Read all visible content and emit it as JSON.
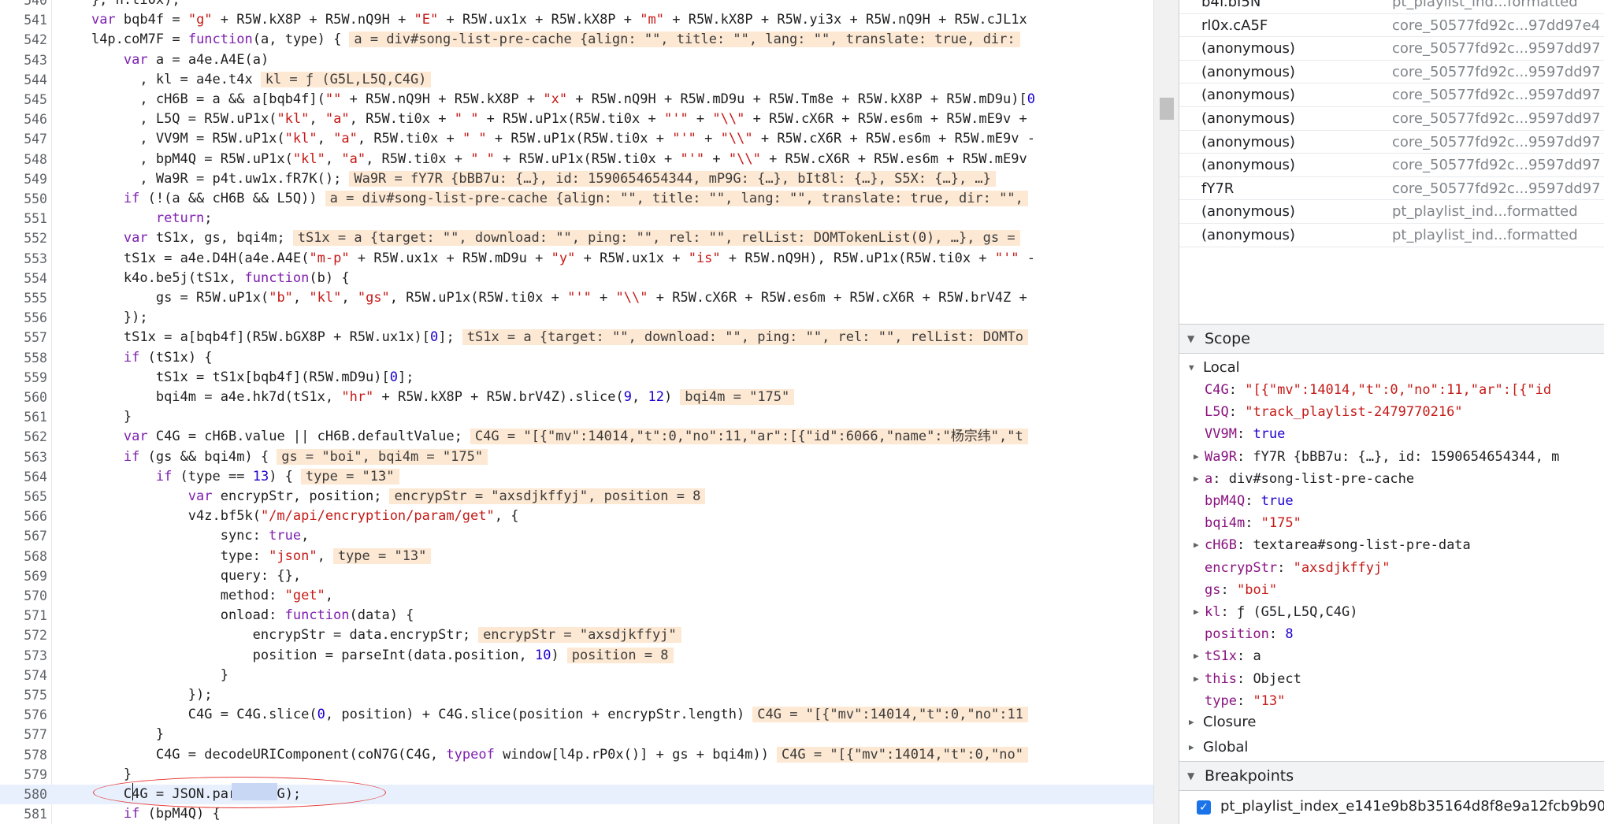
{
  "editor": {
    "lines": [
      {
        "n": "540",
        "code": "    }, h.ti0x);"
      },
      {
        "n": "541",
        "code": "    var bqb4f = \"g\" + R5W.kX8P + R5W.nQ9H + \"E\" + R5W.ux1x + R5W.kX8P + \"m\" + R5W.kX8P + R5W.yi3x + R5W.nQ9H + R5W.cJL1x"
      },
      {
        "n": "542",
        "code": "    l4p.coM7F = function(a, type) {",
        "inline": "a = div#song-list-pre-cache {align: \"\", title: \"\", lang: \"\", translate: true, dir:"
      },
      {
        "n": "543",
        "code": "        var a = a4e.A4E(a)"
      },
      {
        "n": "544",
        "code": "          , kl = a4e.t4x",
        "inline": "kl = ƒ (G5L,L5Q,C4G)"
      },
      {
        "n": "545",
        "code": "          , cH6B = a && a[bqb4f](\"\" + R5W.nQ9H + R5W.kX8P + \"x\" + R5W.nQ9H + R5W.mD9u + R5W.Tm8e + R5W.kX8P + R5W.mD9u)[0"
      },
      {
        "n": "546",
        "code": "          , L5Q = R5W.uP1x(\"kl\", \"a\", R5W.ti0x + \" \" + R5W.uP1x(R5W.ti0x + \"'\" + \"\\\\\" + R5W.cX6R + R5W.es6m + R5W.mE9v +"
      },
      {
        "n": "547",
        "code": "          , VV9M = R5W.uP1x(\"kl\", \"a\", R5W.ti0x + \" \" + R5W.uP1x(R5W.ti0x + \"'\" + \"\\\\\" + R5W.cX6R + R5W.es6m + R5W.mE9v -"
      },
      {
        "n": "548",
        "code": "          , bpM4Q = R5W.uP1x(\"kl\", \"a\", R5W.ti0x + \" \" + R5W.uP1x(R5W.ti0x + \"'\" + \"\\\\\" + R5W.cX6R + R5W.es6m + R5W.mE9v"
      },
      {
        "n": "549",
        "code": "          , Wa9R = p4t.uw1x.fR7K();",
        "inline": "Wa9R = fY7R {bBB7u: {…}, id: 1590654654344, mP9G: {…}, bIt8l: {…}, S5X: {…}, …}"
      },
      {
        "n": "550",
        "code": "        if (!(a && cH6B && L5Q))",
        "inline": "a = div#song-list-pre-cache {align: \"\", title: \"\", lang: \"\", translate: true, dir: \"\","
      },
      {
        "n": "551",
        "code": "            return;"
      },
      {
        "n": "552",
        "code": "        var tS1x, gs, bqi4m;",
        "inline": "tS1x = a {target: \"\", download: \"\", ping: \"\", rel: \"\", relList: DOMTokenList(0), …}, gs ="
      },
      {
        "n": "553",
        "code": "        tS1x = a4e.D4H(a4e.A4E(\"m-p\" + R5W.ux1x + R5W.mD9u + \"y\" + R5W.ux1x + \"is\" + R5W.nQ9H), R5W.uP1x(R5W.ti0x + \"'\" -"
      },
      {
        "n": "554",
        "code": "        k4o.be5j(tS1x, function(b) {"
      },
      {
        "n": "555",
        "code": "            gs = R5W.uP1x(\"b\", \"kl\", \"gs\", R5W.uP1x(R5W.ti0x + \"'\" + \"\\\\\" + R5W.cX6R + R5W.es6m + R5W.cX6R + R5W.brV4Z +"
      },
      {
        "n": "556",
        "code": "        });"
      },
      {
        "n": "557",
        "code": "        tS1x = a[bqb4f](R5W.bGX8P + R5W.ux1x)[0];",
        "inline": "tS1x = a {target: \"\", download: \"\", ping: \"\", rel: \"\", relList: DOMTo"
      },
      {
        "n": "558",
        "code": "        if (tS1x) {"
      },
      {
        "n": "559",
        "code": "            tS1x = tS1x[bqb4f](R5W.mD9u)[0];"
      },
      {
        "n": "560",
        "code": "            bqi4m = a4e.hk7d(tS1x, \"hr\" + R5W.kX8P + R5W.brV4Z).slice(9, 12)",
        "inline": "bqi4m = \"175\""
      },
      {
        "n": "561",
        "code": "        }"
      },
      {
        "n": "562",
        "code": "        var C4G = cH6B.value || cH6B.defaultValue;",
        "inline": "C4G = \"[{\"mv\":14014,\"t\":0,\"no\":11,\"ar\":[{\"id\":6066,\"name\":\"杨宗纬\",\"t"
      },
      {
        "n": "563",
        "code": "        if (gs && bqi4m) {",
        "inline": "gs = \"boi\", bqi4m = \"175\""
      },
      {
        "n": "564",
        "code": "            if (type == 13) {",
        "inline": "type = \"13\""
      },
      {
        "n": "565",
        "code": "                var encrypStr, position;",
        "inline": "encrypStr = \"axsdjkffyj\", position = 8"
      },
      {
        "n": "566",
        "code": "                v4z.bf5k(\"/m/api/encryption/param/get\", {"
      },
      {
        "n": "567",
        "code": "                    sync: true,"
      },
      {
        "n": "568",
        "code": "                    type: \"json\",",
        "inline": "type = \"13\""
      },
      {
        "n": "569",
        "code": "                    query: {},"
      },
      {
        "n": "570",
        "code": "                    method: \"get\","
      },
      {
        "n": "571",
        "code": "                    onload: function(data) {"
      },
      {
        "n": "572",
        "code": "                        encrypStr = data.encrypStr;",
        "inline": "encrypStr = \"axsdjkffyj\""
      },
      {
        "n": "573",
        "code": "                        position = parseInt(data.position, 10)",
        "inline": "position = 8"
      },
      {
        "n": "574",
        "code": "                    }"
      },
      {
        "n": "575",
        "code": "                });"
      },
      {
        "n": "576",
        "code": "                C4G = C4G.slice(0, position) + C4G.slice(position + encrypStr.length)",
        "inline": "C4G = \"[{\"mv\":14014,\"t\":0,\"no\":11"
      },
      {
        "n": "577",
        "code": "            }"
      },
      {
        "n": "578",
        "code": "            C4G = decodeURIComponent(coN7G(C4G, typeof window[l4p.rP0x()] + gs + bqi4m))",
        "inline": "C4G = \"[{\"mv\":14014,\"t\":0,\"no\""
      },
      {
        "n": "579",
        "code": "        }"
      },
      {
        "n": "580",
        "code": "        C4G = JSON.parse(C4G);",
        "current": true
      },
      {
        "n": "581",
        "code": "        if (bpM4Q) {"
      }
    ]
  },
  "callstack": [
    {
      "fn": "b4f.bI5N",
      "loc": "pt_playlist_ind...formatted"
    },
    {
      "fn": "rl0x.cA5F",
      "loc": "core_50577fd92c...97dd97e4"
    },
    {
      "fn": "(anonymous)",
      "loc": "core_50577fd92c...9597dd97"
    },
    {
      "fn": "(anonymous)",
      "loc": "core_50577fd92c...9597dd97"
    },
    {
      "fn": "(anonymous)",
      "loc": "core_50577fd92c...9597dd97"
    },
    {
      "fn": "(anonymous)",
      "loc": "core_50577fd92c...9597dd97"
    },
    {
      "fn": "(anonymous)",
      "loc": "core_50577fd92c...9597dd97"
    },
    {
      "fn": "(anonymous)",
      "loc": "core_50577fd92c...9597dd97"
    },
    {
      "fn": "fY7R",
      "loc": "core_50577fd92c...9597dd97"
    },
    {
      "fn": "(anonymous)",
      "loc": "pt_playlist_ind...formatted"
    },
    {
      "fn": "(anonymous)",
      "loc": "pt_playlist_ind...formatted"
    }
  ],
  "scope": {
    "title": "Scope",
    "local_label": "Local",
    "vars": [
      {
        "expand": false,
        "name": "C4G",
        "val": "\"[{\"mv\":14014,\"t\":0,\"no\":11,\"ar\":[{\"id",
        "kind": "str"
      },
      {
        "expand": false,
        "name": "L5Q",
        "val": "\"track_playlist-2479770216\"",
        "kind": "str"
      },
      {
        "expand": false,
        "name": "VV9M",
        "val": "true",
        "kind": "bool"
      },
      {
        "expand": true,
        "name": "Wa9R",
        "val": "fY7R {bBB7u: {…}, id: 1590654654344, m",
        "kind": "obj"
      },
      {
        "expand": true,
        "name": "a",
        "val": "div#song-list-pre-cache",
        "kind": "obj"
      },
      {
        "expand": false,
        "name": "bpM4Q",
        "val": "true",
        "kind": "bool"
      },
      {
        "expand": false,
        "name": "bqi4m",
        "val": "\"175\"",
        "kind": "str"
      },
      {
        "expand": true,
        "name": "cH6B",
        "val": "textarea#song-list-pre-data",
        "kind": "obj"
      },
      {
        "expand": false,
        "name": "encrypStr",
        "val": "\"axsdjkffyj\"",
        "kind": "str"
      },
      {
        "expand": false,
        "name": "gs",
        "val": "\"boi\"",
        "kind": "str"
      },
      {
        "expand": true,
        "name": "kl",
        "val": "ƒ (G5L,L5Q,C4G)",
        "kind": "obj"
      },
      {
        "expand": false,
        "name": "position",
        "val": "8",
        "kind": "num"
      },
      {
        "expand": true,
        "name": "tS1x",
        "val": "a",
        "kind": "obj"
      },
      {
        "expand": true,
        "name": "this",
        "val": "Object",
        "kind": "obj"
      },
      {
        "expand": false,
        "name": "type",
        "val": "\"13\"",
        "kind": "str"
      }
    ],
    "closure_label": "Closure",
    "global_label": "Global"
  },
  "breakpoints": {
    "title": "Breakpoints",
    "item": "pt_playlist_index_e141e9b8b35164d8f8e9a12fcb9b90",
    "checked": true
  },
  "colors": {
    "inline_value_bg": "#fde8d3",
    "current_line_bg": "#e8f0fe",
    "annotation_circle": "#e53935"
  }
}
